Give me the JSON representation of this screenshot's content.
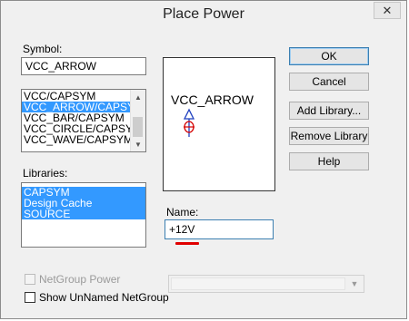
{
  "window": {
    "title": "Place Power",
    "close_glyph": "✕"
  },
  "symbol": {
    "label": "Symbol:",
    "value": "VCC_ARROW"
  },
  "symbol_list": {
    "items": [
      "VCC/CAPSYM",
      "VCC_ARROW/CAPSYM",
      "VCC_BAR/CAPSYM",
      "VCC_CIRCLE/CAPSYM",
      "VCC_WAVE/CAPSYM"
    ],
    "selected_index": 1
  },
  "libraries": {
    "label": "Libraries:",
    "items": [
      "CAPSYM",
      "Design Cache",
      "SOURCE"
    ]
  },
  "preview": {
    "symbol_text": "VCC_ARROW",
    "icon": "vcc-arrow-symbol-icon"
  },
  "name_field": {
    "label": "Name:",
    "value": "+12V"
  },
  "buttons": {
    "ok": "OK",
    "cancel": "Cancel",
    "add_library": "Add Library...",
    "remove_library": "Remove Library",
    "help": "Help"
  },
  "options": {
    "netgroup_power": "NetGroup Power",
    "show_unnamed": "Show UnNamed NetGroup"
  },
  "colors": {
    "selection": "#3399ff",
    "annotation_underline": "#e00000",
    "symbol_red": "#d40000",
    "symbol_blue": "#1f3fbf"
  }
}
